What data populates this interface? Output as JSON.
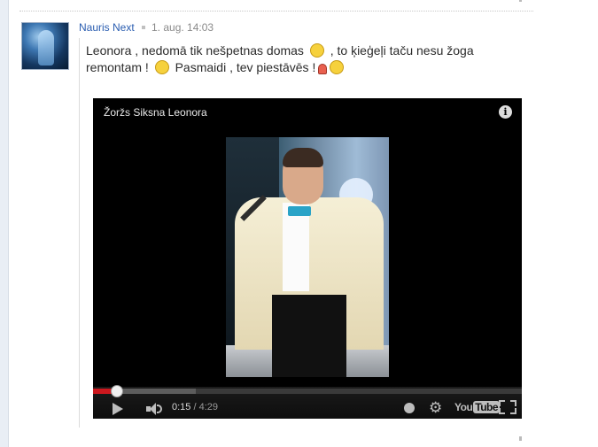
{
  "comment": {
    "author": "Nauris Next",
    "timestamp": "1. aug. 14:03",
    "text_1": "Leonora , nedomā tik nešpetnas domas",
    "text_2": ", to ķieģeļi taču nesu žoga remontam !",
    "text_3": "Pasmaidi , tev piestāvēs !",
    "emoticons": [
      "shocked-emoticon",
      "grin-emoticon",
      "flower-emoticon",
      "smile-emoticon"
    ]
  },
  "video": {
    "title": "Žoržs Siksna Leonora",
    "info_icon": "i",
    "current_time": "0:15",
    "separator": " / ",
    "duration": "4:29",
    "progress_fraction": 0.056,
    "buffered_fraction": 0.24,
    "logo_you": "You",
    "logo_tube": "Tube",
    "progress_color": "#cc181e"
  },
  "colors": {
    "author": "#2a5db0",
    "timestamp": "#8a8a8a",
    "player_bg": "#000000"
  }
}
